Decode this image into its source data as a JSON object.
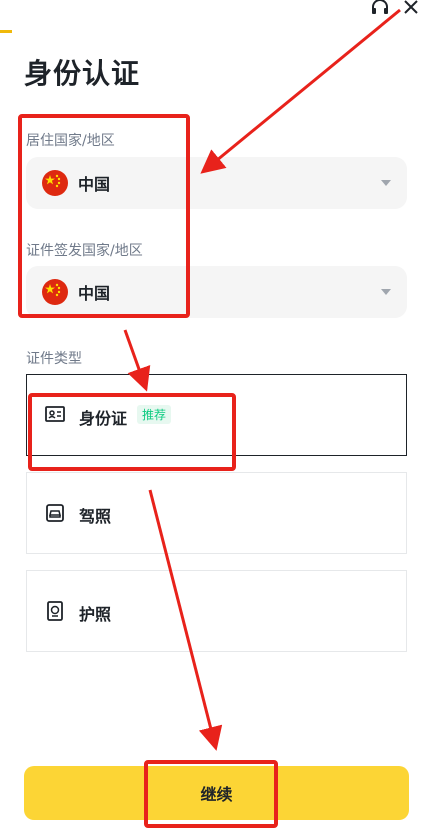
{
  "page": {
    "title": "身份认证"
  },
  "residence": {
    "label": "居住国家/地区",
    "value": "中国"
  },
  "issuing": {
    "label": "证件签发国家/地区",
    "value": "中国"
  },
  "doc_type": {
    "label": "证件类型",
    "options": [
      {
        "label": "身份证",
        "badge": "推荐",
        "icon": "id-card-icon",
        "selected": true
      },
      {
        "label": "驾照",
        "icon": "driver-license-icon",
        "selected": false
      },
      {
        "label": "护照",
        "icon": "passport-icon",
        "selected": false
      }
    ]
  },
  "footer": {
    "continue_label": "继续"
  },
  "colors": {
    "brand": "#fcd535",
    "annotation": "#e8221b",
    "badge": "#0ecb81"
  }
}
